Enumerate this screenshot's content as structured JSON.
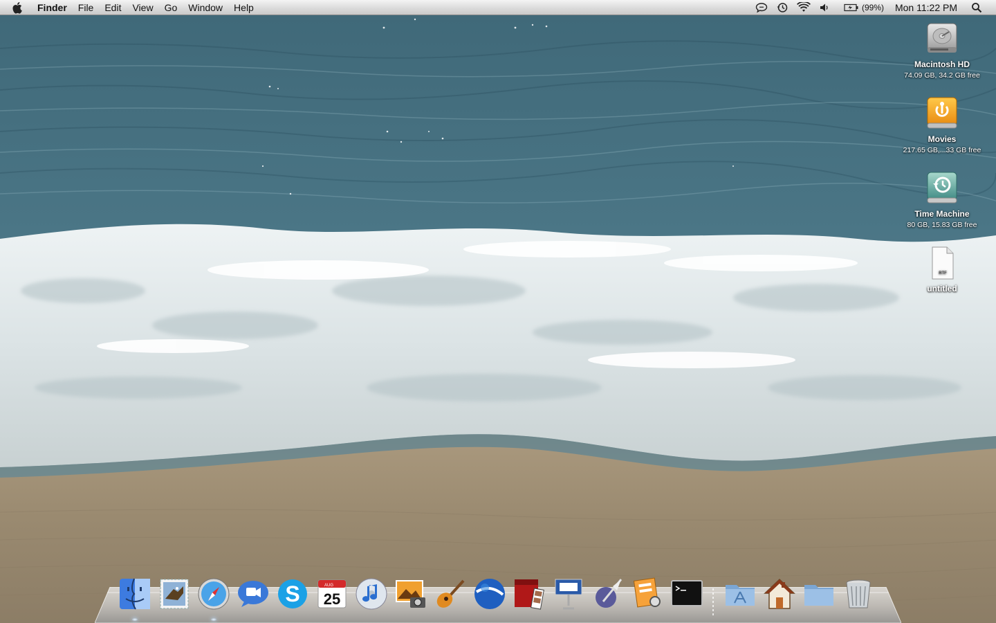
{
  "menubar": {
    "apple_icon": "apple-logo-icon",
    "app_name": "Finder",
    "menus": [
      "File",
      "Edit",
      "View",
      "Go",
      "Window",
      "Help"
    ],
    "status_icons": [
      "ichat-status-icon",
      "time-machine-icon",
      "wifi-icon",
      "volume-icon",
      "battery-icon"
    ],
    "battery_percent": "(99%)",
    "clock": "Mon 11:22 PM",
    "spotlight_icon": "spotlight-search-icon"
  },
  "desktop": {
    "icons": [
      {
        "name": "Macintosh HD",
        "info": "74.09 GB, 34.2 GB free",
        "icon": "hard-drive-icon"
      },
      {
        "name": "Movies",
        "info": "217.65 GB,...33 GB free",
        "icon": "firewire-drive-icon"
      },
      {
        "name": "Time Machine",
        "info": "80 GB, 15.83 GB free",
        "icon": "time-machine-drive-icon"
      },
      {
        "name": "untitled",
        "info": "",
        "icon": "rtf-document-icon",
        "badge": "RTF"
      }
    ]
  },
  "dock": {
    "apps": [
      {
        "name": "Finder",
        "icon": "finder-icon",
        "running": true
      },
      {
        "name": "Mail",
        "icon": "mail-stamp-icon",
        "running": false
      },
      {
        "name": "Safari",
        "icon": "safari-compass-icon",
        "running": true
      },
      {
        "name": "iChat",
        "icon": "ichat-icon",
        "running": false
      },
      {
        "name": "Skype",
        "icon": "skype-icon",
        "running": false
      },
      {
        "name": "iCal",
        "icon": "ical-calendar-icon",
        "running": false,
        "month": "AUG",
        "day": "25"
      },
      {
        "name": "iTunes",
        "icon": "itunes-icon",
        "running": false
      },
      {
        "name": "iPhoto",
        "icon": "iphoto-icon",
        "running": false
      },
      {
        "name": "GarageBand",
        "icon": "garageband-guitar-icon",
        "running": false
      },
      {
        "name": "Google Earth",
        "icon": "google-earth-icon",
        "running": false
      },
      {
        "name": "Photo Booth",
        "icon": "photo-booth-icon",
        "running": false
      },
      {
        "name": "Keynote",
        "icon": "keynote-podium-icon",
        "running": false
      },
      {
        "name": "Script Editor",
        "icon": "script-editor-quill-icon",
        "running": false
      },
      {
        "name": "Preview",
        "icon": "preview-icon",
        "running": false
      },
      {
        "name": "Terminal",
        "icon": "terminal-icon",
        "running": false
      }
    ],
    "stacks": [
      {
        "name": "Applications",
        "icon": "applications-folder-icon"
      },
      {
        "name": "Home",
        "icon": "home-house-icon"
      },
      {
        "name": "Documents",
        "icon": "documents-folder-icon"
      },
      {
        "name": "Trash",
        "icon": "trash-icon"
      }
    ]
  },
  "colors": {
    "sea_deep": "#2f5a6b",
    "sea_mid": "#4d7686",
    "foam": "#e8eef0",
    "sand": "#9a8b72",
    "menubar": "#e4e4e4"
  }
}
